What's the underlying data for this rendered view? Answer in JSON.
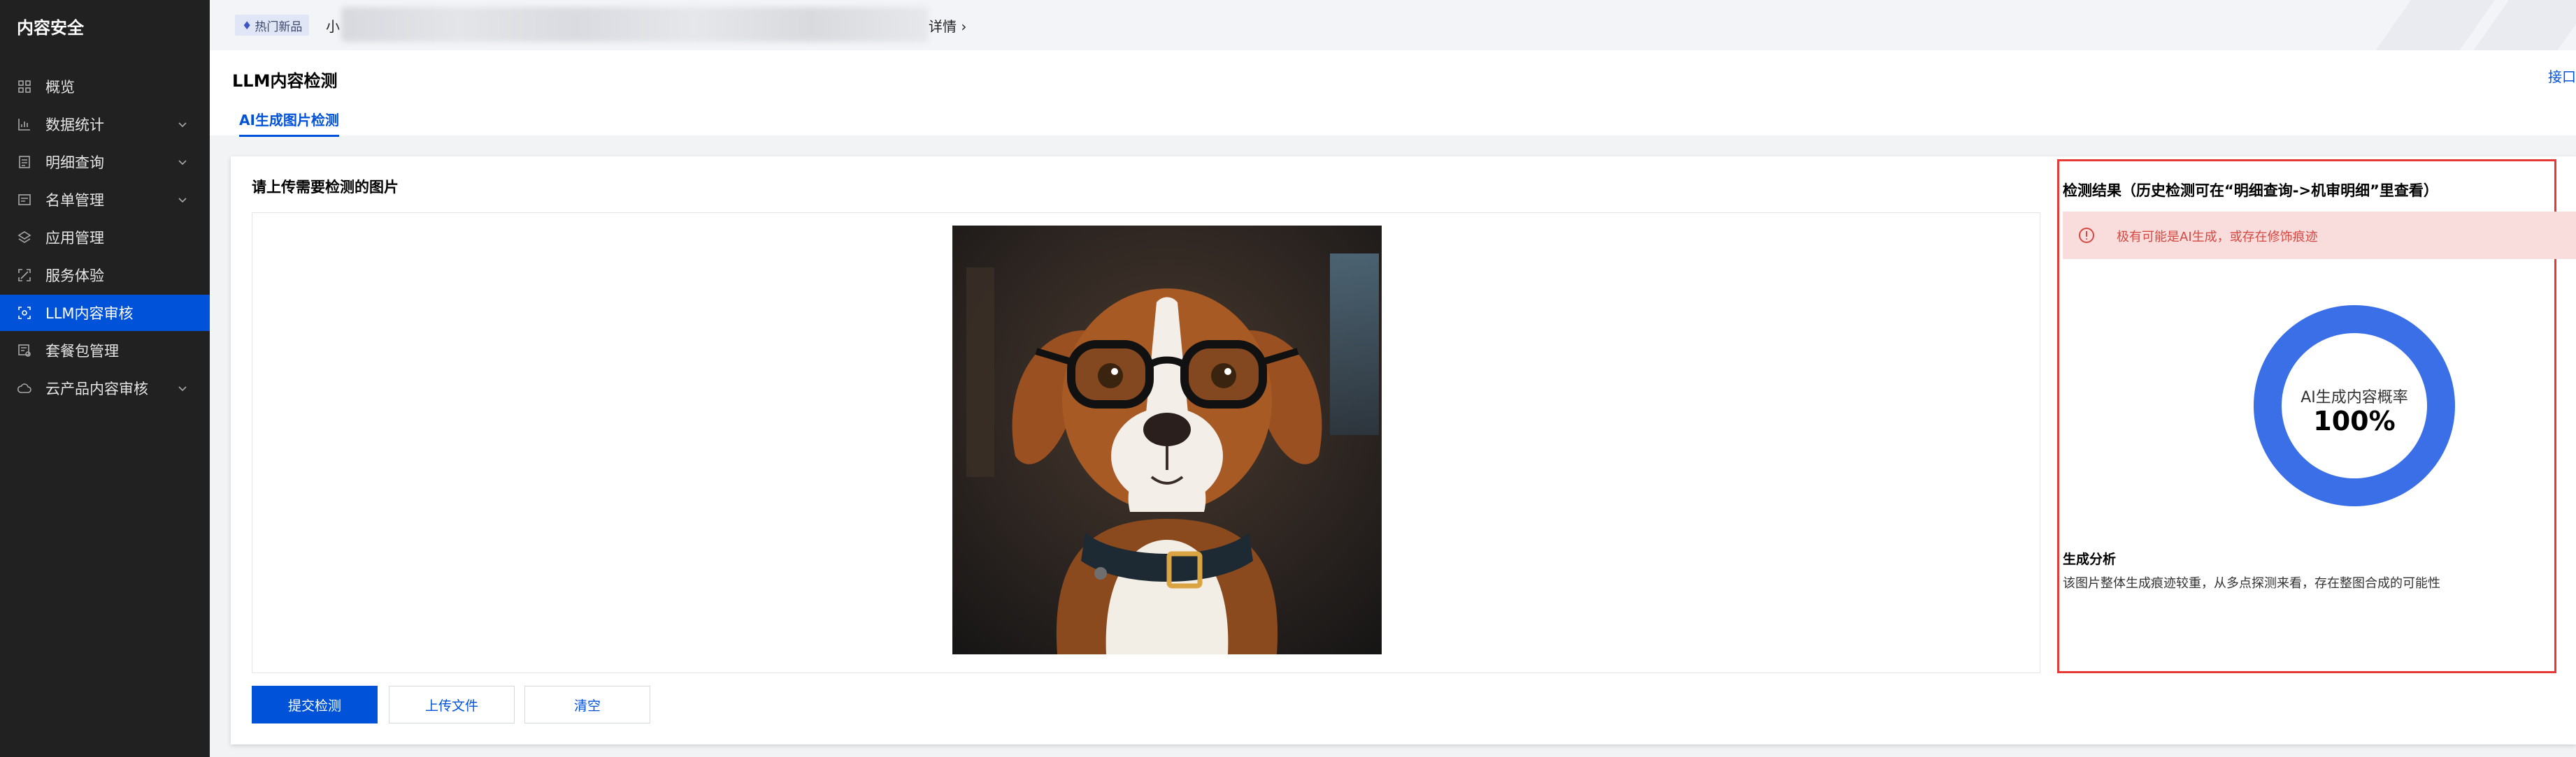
{
  "sidebar": {
    "title": "内容安全",
    "items": [
      {
        "label": "概览",
        "icon": "grid-icon",
        "has_chevron": false,
        "active": false
      },
      {
        "label": "数据统计",
        "icon": "bar-chart-icon",
        "has_chevron": true,
        "active": false
      },
      {
        "label": "明细查询",
        "icon": "document-icon",
        "has_chevron": true,
        "active": false
      },
      {
        "label": "名单管理",
        "icon": "list-icon",
        "has_chevron": true,
        "active": false
      },
      {
        "label": "应用管理",
        "icon": "layers-icon",
        "has_chevron": false,
        "active": false
      },
      {
        "label": "服务体验",
        "icon": "expand-icon",
        "has_chevron": false,
        "active": false
      },
      {
        "label": "LLM内容审核",
        "icon": "scan-icon",
        "has_chevron": false,
        "active": true
      },
      {
        "label": "套餐包管理",
        "icon": "package-icon",
        "has_chevron": false,
        "active": false
      },
      {
        "label": "云产品内容审核",
        "icon": "cloud-icon",
        "has_chevron": true,
        "active": false
      }
    ]
  },
  "topbar": {
    "badge_label": "热门新品",
    "badge_icon": "fire-icon",
    "notice_prefix": "小",
    "notice_link": "详情 ›"
  },
  "header": {
    "title": "LLM内容检测",
    "top_right_link": "接口",
    "tab_label": "AI生成图片检测"
  },
  "upload": {
    "title": "请上传需要检测的图片",
    "image_subject": "dog-with-glasses-image"
  },
  "buttons": {
    "submit": "提交检测",
    "upload_file": "上传文件",
    "clear": "清空"
  },
  "result": {
    "title": "检测结果（历史检测可在“明细查询->机审明细”里查看）",
    "alert_text": "极有可能是AI生成，或存在修饰痕迹",
    "alert_icon": "error-circle-icon",
    "donut_label": "AI生成内容概率",
    "donut_value_text": "100%",
    "donut_fraction": 1.0,
    "analysis_title": "生成分析",
    "analysis_text": "该图片整体生成痕迹较重，从多点探测来看，存在整图合成的可能性"
  },
  "colors": {
    "sidebar_bg": "#212121",
    "accent": "#0052d9",
    "donut": "#3a6fe8",
    "alert_bg": "#f9dcdc",
    "alert_text": "#d54941",
    "highlight_border": "#e53935"
  }
}
